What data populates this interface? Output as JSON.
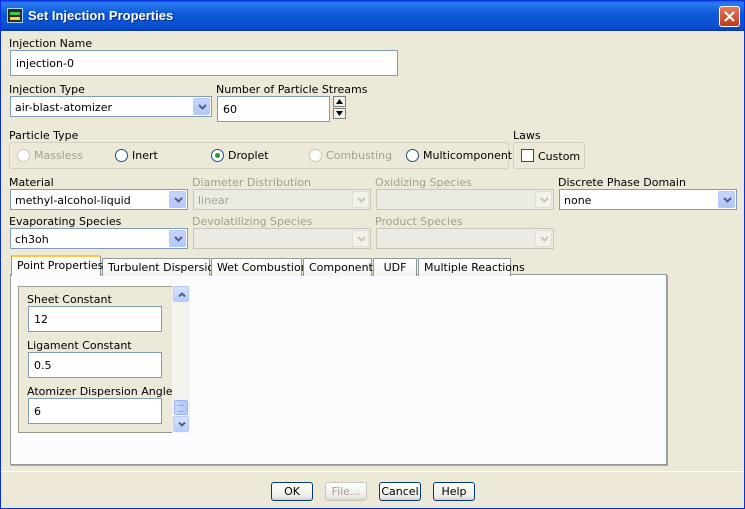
{
  "window": {
    "title": "Set Injection Properties"
  },
  "injection_name": {
    "label": "Injection Name",
    "value": "injection-0"
  },
  "injection_type": {
    "label": "Injection Type",
    "value": "air-blast-atomizer"
  },
  "particle_streams": {
    "label": "Number of Particle Streams",
    "value": "60"
  },
  "particle_type": {
    "label": "Particle Type",
    "options": [
      {
        "label": "Massless",
        "checked": false,
        "disabled": true
      },
      {
        "label": "Inert",
        "checked": false,
        "disabled": false
      },
      {
        "label": "Droplet",
        "checked": true,
        "disabled": false
      },
      {
        "label": "Combusting",
        "checked": false,
        "disabled": true
      },
      {
        "label": "Multicomponent",
        "checked": false,
        "disabled": false
      }
    ]
  },
  "laws": {
    "label": "Laws",
    "custom_label": "Custom",
    "custom_checked": false
  },
  "material": {
    "label": "Material",
    "value": "methyl-alcohol-liquid"
  },
  "diameter_distribution": {
    "label": "Diameter Distribution",
    "value": "linear"
  },
  "oxidizing_species": {
    "label": "Oxidizing Species",
    "value": ""
  },
  "discrete_phase_domain": {
    "label": "Discrete Phase Domain",
    "value": "none"
  },
  "evaporating_species": {
    "label": "Evaporating Species",
    "value": "ch3oh"
  },
  "devolatilizing_species": {
    "label": "Devolatilizing Species",
    "value": ""
  },
  "product_species": {
    "label": "Product Species",
    "value": ""
  },
  "tabs": [
    {
      "label": "Point Properties",
      "active": true
    },
    {
      "label": "Turbulent Dispersion",
      "active": false
    },
    {
      "label": "Wet Combustion",
      "active": false
    },
    {
      "label": "Components",
      "active": false
    },
    {
      "label": "UDF",
      "active": false
    },
    {
      "label": "Multiple Reactions",
      "active": false
    }
  ],
  "point_properties": {
    "sheet_constant": {
      "label": "Sheet Constant",
      "value": "12"
    },
    "ligament_constant": {
      "label": "Ligament Constant",
      "value": "0.5"
    },
    "atomizer_dispersion_angle": {
      "label": "Atomizer Dispersion Angle",
      "value": "6"
    }
  },
  "buttons": {
    "ok": "OK",
    "file": "File...",
    "cancel": "Cancel",
    "help": "Help"
  }
}
